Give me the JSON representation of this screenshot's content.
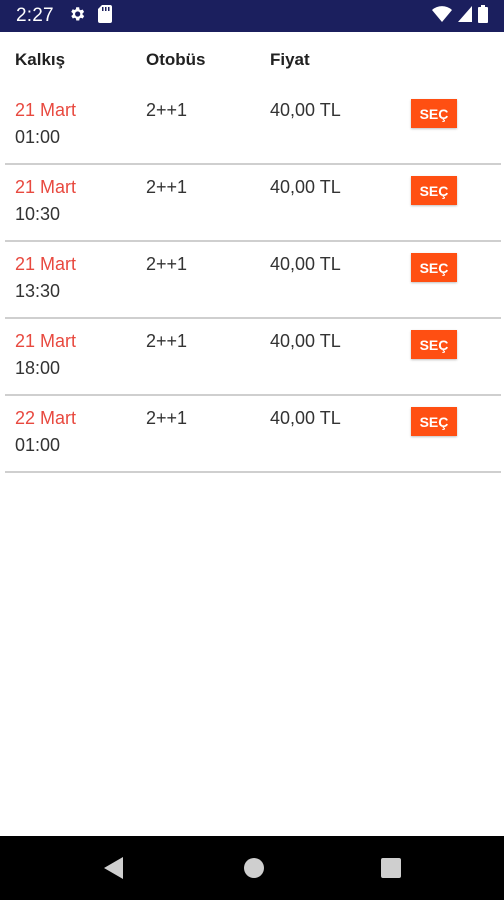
{
  "status_bar": {
    "time": "2:27",
    "icons": [
      "settings-icon",
      "sd-card-icon",
      "wifi-icon",
      "cell-signal-icon",
      "battery-icon"
    ],
    "background": "#1b1f5e"
  },
  "header": {
    "departure": "Kalkış",
    "bus": "Otobüs",
    "price": "Fiyat"
  },
  "trips": [
    {
      "date": "21 Mart",
      "time": "01:00",
      "bus": "2++1",
      "price": "40,00 TL",
      "select_label": "SEÇ"
    },
    {
      "date": "21 Mart",
      "time": "10:30",
      "bus": "2++1",
      "price": "40,00 TL",
      "select_label": "SEÇ"
    },
    {
      "date": "21 Mart",
      "time": "13:30",
      "bus": "2++1",
      "price": "40,00 TL",
      "select_label": "SEÇ"
    },
    {
      "date": "21 Mart",
      "time": "18:00",
      "bus": "2++1",
      "price": "40,00 TL",
      "select_label": "SEÇ"
    },
    {
      "date": "22 Mart",
      "time": "01:00",
      "bus": "2++1",
      "price": "40,00 TL",
      "select_label": "SEÇ"
    }
  ],
  "nav_bar": {
    "buttons": [
      "back-icon",
      "home-icon",
      "recents-icon"
    ]
  },
  "colors": {
    "accent": "#ff4f12",
    "date_text": "#e8493f",
    "divider": "#cfcfcf"
  }
}
